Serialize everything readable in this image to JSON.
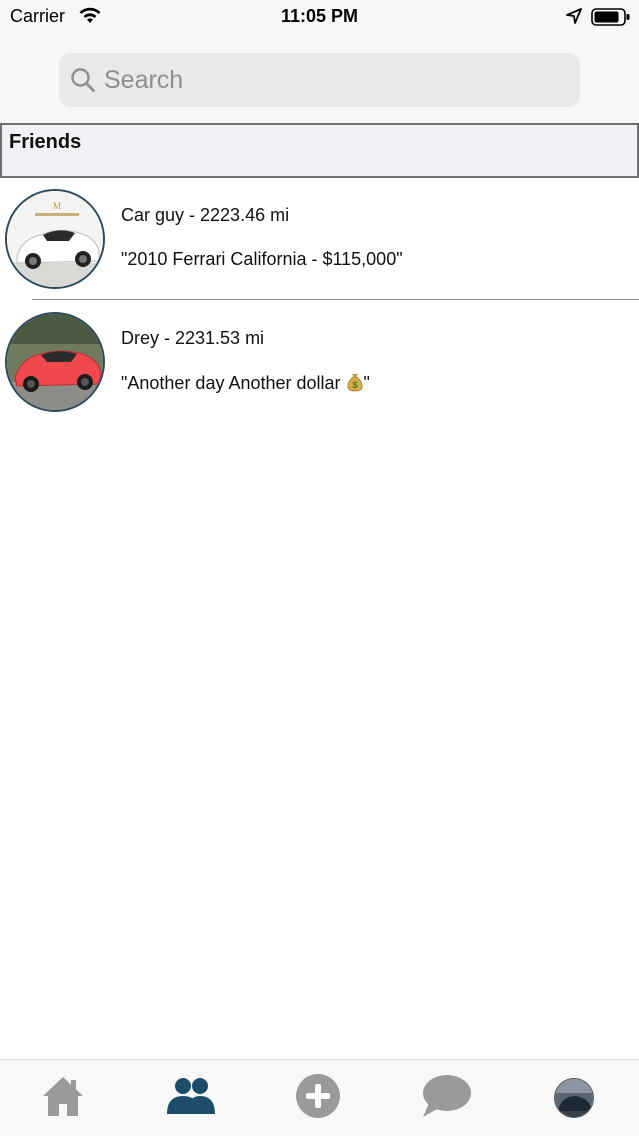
{
  "status_bar": {
    "carrier": "Carrier",
    "time": "11:05 PM"
  },
  "search": {
    "placeholder": "Search"
  },
  "section": {
    "title": "Friends"
  },
  "friends": [
    {
      "title": "Car guy - 2223.46 mi",
      "status": "\"2010 Ferrari California - $115,000\"",
      "avatar": "white-ferrari-photo"
    },
    {
      "title": "Drey - 2231.53 mi",
      "status_text": "\"Another day Another dollar ",
      "status_emoji": "money-bag",
      "status_close": "\"",
      "avatar": "red-lamborghini-photo"
    }
  ],
  "tab_bar": {
    "items": [
      {
        "name": "home",
        "icon": "home-icon",
        "active": false
      },
      {
        "name": "friends",
        "icon": "people-icon",
        "active": true
      },
      {
        "name": "add",
        "icon": "plus-circle-icon",
        "active": false
      },
      {
        "name": "messages",
        "icon": "chat-bubble-icon",
        "active": false
      },
      {
        "name": "profile",
        "icon": "profile-avatar",
        "active": false
      }
    ]
  },
  "colors": {
    "active_tab": "#1e4d6b",
    "inactive_tab": "#9a9a9a",
    "avatar_ring": "#2c4a5c",
    "search_bg": "#e9e9eb"
  }
}
